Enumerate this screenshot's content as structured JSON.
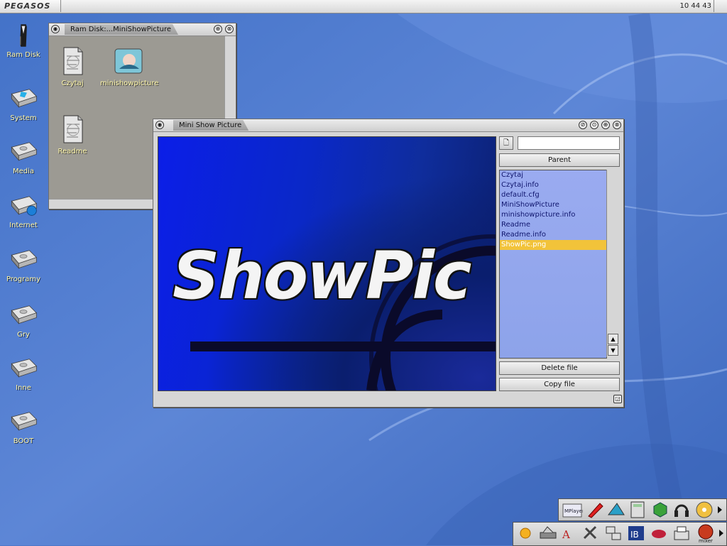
{
  "screen": {
    "brand": "PEGASOS",
    "clock": "10 44 43"
  },
  "desktop_icons": [
    {
      "label": "Ram Disk"
    },
    {
      "label": "System"
    },
    {
      "label": "Media"
    },
    {
      "label": "Internet"
    },
    {
      "label": "Programy"
    },
    {
      "label": "Gry"
    },
    {
      "label": "Inne"
    },
    {
      "label": "BOOT"
    }
  ],
  "ramdisk_window": {
    "title": "Ram Disk:...MiniShowPicture",
    "files": [
      {
        "label": "Czytaj"
      },
      {
        "label": "minishowpicture"
      },
      {
        "label": "Readme"
      }
    ]
  },
  "showpic_window": {
    "title": "Mini Show Picture",
    "image_text": "ShowPic",
    "path_value": "",
    "parent_label": "Parent",
    "files": [
      "Czytaj",
      "Czytaj.info",
      "default.cfg",
      "MiniShowPicture",
      "minishowpicture.info",
      "Readme",
      "Readme.info",
      "ShowPic.png"
    ],
    "selected_file": "ShowPic.png",
    "delete_label": "Delete file",
    "copy_label": "Copy file"
  },
  "dock": {
    "top_row": [
      "mplayer-icon",
      "pen-icon",
      "paint-icon",
      "calculator-icon",
      "cube-icon",
      "headphones-icon",
      "cd-icon"
    ],
    "bottom_row": [
      "sun-icon",
      "scanner-icon",
      "text-icon",
      "tools-icon",
      "network-icon",
      "ib-icon",
      "fish-icon",
      "fax-icon",
      "mixer-icon"
    ],
    "bottom_right_label": "mixer"
  },
  "colors": {
    "desktop": "#4f78c9",
    "label_text": "#fff7a8",
    "list_bg": "#9aabf0",
    "selection": "#f2c33a"
  }
}
